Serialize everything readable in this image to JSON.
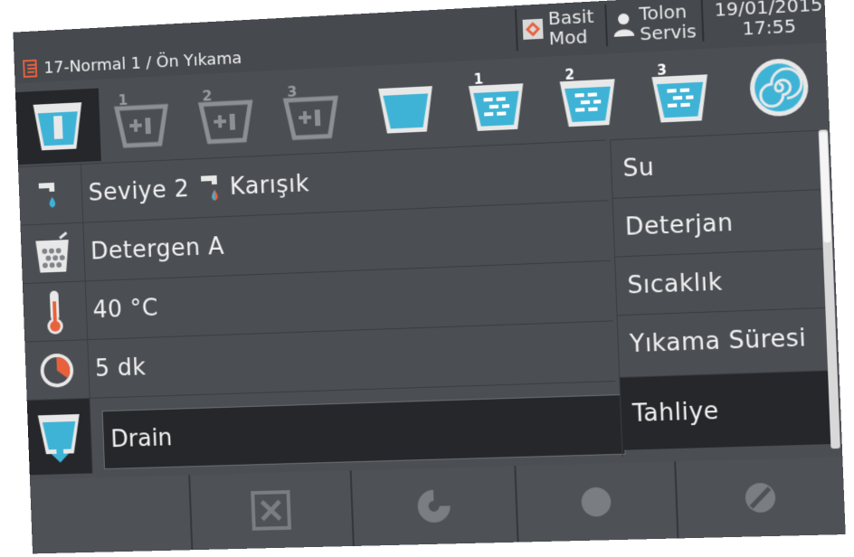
{
  "header": {
    "program_title": "17-Normal 1 / Ön Yıkama",
    "mode": {
      "line1": "Basit",
      "line2": "Mod",
      "icon": "diamond-icon"
    },
    "user": {
      "line1": "Tolon",
      "line2": "Servis",
      "icon": "user-icon"
    },
    "clock": {
      "date": "19/01/2015",
      "time": "17:55"
    }
  },
  "steps": [
    {
      "name": "prewash-active",
      "badge": "",
      "icon": "tub-fill-icon"
    },
    {
      "name": "add-detergent-1",
      "badge": "1",
      "icon": "add-detergent-icon"
    },
    {
      "name": "add-detergent-2",
      "badge": "2",
      "icon": "add-detergent-icon"
    },
    {
      "name": "add-detergent-3",
      "badge": "3",
      "icon": "add-detergent-icon"
    },
    {
      "name": "water-tub",
      "badge": "",
      "icon": "water-tub-icon"
    },
    {
      "name": "rinse-1",
      "badge": "1",
      "icon": "rinse-icon"
    },
    {
      "name": "rinse-2",
      "badge": "2",
      "icon": "rinse-icon"
    },
    {
      "name": "rinse-3",
      "badge": "3",
      "icon": "rinse-icon"
    },
    {
      "name": "spin",
      "badge": "",
      "icon": "spin-icon"
    }
  ],
  "rows": {
    "water": {
      "level": "Seviye 2",
      "mix": "Karışık"
    },
    "detergent": {
      "value": "Detergen A"
    },
    "temperature": {
      "value": "40 °C"
    },
    "duration": {
      "value": "5 dk"
    },
    "drain": {
      "value": "Drain"
    }
  },
  "labels": [
    "Su",
    "Deterjan",
    "Sıcaklık",
    "Yıkama Süresi",
    "Tahliye"
  ],
  "selected_label_index": 4,
  "colors": {
    "accent_blue": "#3fb3d6",
    "accent_orange": "#e8613c",
    "bg": "#4b4e53",
    "selected": "#25272a"
  }
}
